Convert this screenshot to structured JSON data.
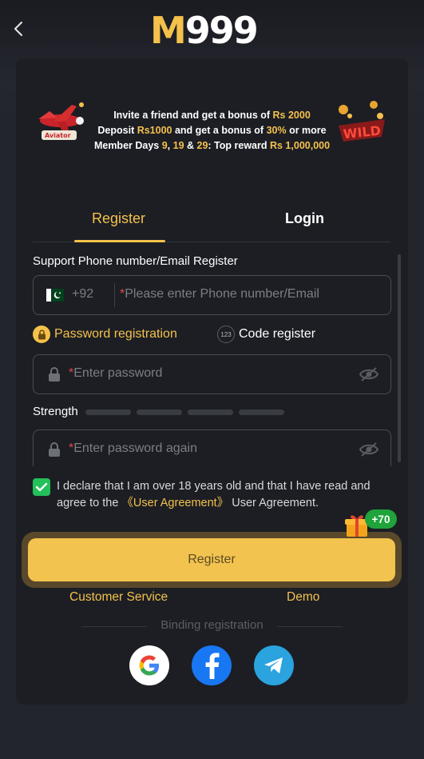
{
  "header": {
    "logo_m": "M",
    "logo_num": "999"
  },
  "banner": {
    "line1": {
      "a": "Invite a friend and get a bonus of ",
      "b": "Rs 2000"
    },
    "line2": {
      "a": "Deposit ",
      "b": "Rs1000",
      "c": " and get a bonus of ",
      "d": "30%",
      "e": " or more"
    },
    "line3": {
      "a": "Member Days ",
      "b": "9",
      "c": ", ",
      "d": "19",
      "e": " & ",
      "f": "29",
      "g": ": Top reward ",
      "h": "Rs 1,000,000"
    },
    "left_image": "aviator-plane",
    "right_image": "wild-badge"
  },
  "tabs": {
    "register": "Register",
    "login": "Login",
    "active": "register"
  },
  "form": {
    "section_label": "Support Phone number/Email Register",
    "phone": {
      "country_flag": "pakistan-flag",
      "prefix": "+92",
      "required_mark": "*",
      "placeholder": "Please enter Phone number/Email",
      "value": ""
    },
    "options": {
      "password_registration": "Password registration",
      "code_register": "Code register",
      "code_icon_text": "123",
      "selected": "password_registration"
    },
    "password": {
      "required_mark": "*",
      "placeholder": "Enter password",
      "value": ""
    },
    "strength": {
      "label": "Strength",
      "level": 0,
      "segments": 4
    },
    "password_again": {
      "required_mark": "*",
      "placeholder": "Enter password again",
      "value": ""
    },
    "agreement": {
      "checked": true,
      "text_before": "I declare that I am over 18 years old and that I have read and agree to the ",
      "link": "《User Agreement》",
      "text_after": " User Agreement."
    }
  },
  "actions": {
    "register_label": "Register",
    "bonus_badge": "+70",
    "customer_service": "Customer Service",
    "demo": "Demo"
  },
  "binding": {
    "label": "Binding registration",
    "providers": [
      "google",
      "facebook",
      "telegram"
    ]
  },
  "colors": {
    "accent": "#f4c14b",
    "background": "#23252d",
    "card": "#1c1e24",
    "checkbox": "#24c05a",
    "facebook": "#1877f2",
    "telegram": "#2aa3de"
  }
}
